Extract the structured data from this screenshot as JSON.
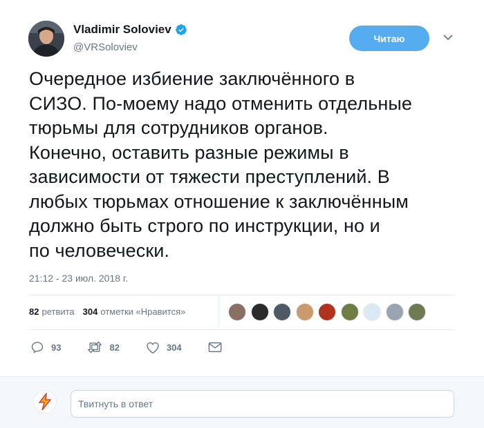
{
  "author": {
    "name": "Vladimir Soloviev",
    "handle": "@VRSoloviev",
    "verified": true
  },
  "follow_button": {
    "label": "Читаю",
    "color": "#55acee"
  },
  "tweet": {
    "lines": [
      "Очередное избиение заключённого в",
      "СИЗО. По-моему надо отменить отдельные",
      "тюрьмы для сотрудников органов.",
      "Конечно, оставить разные режимы в",
      "зависимости от тяжести преступлений. В",
      "любых тюрьмах отношение к заключённым",
      "должно быть строго по инструкции, но и",
      "по человечески."
    ],
    "timestamp": "21:12 - 23 июл. 2018 г."
  },
  "stats": {
    "retweets_count": "82",
    "retweets_label": "ретвита",
    "likes_count": "304",
    "likes_label": "отметки «Нравится»"
  },
  "likers": [
    {
      "color": "#8a6f63"
    },
    {
      "color": "#2b2b2b"
    },
    {
      "color": "#4f5a66"
    },
    {
      "color": "#c99a6e"
    },
    {
      "color": "#b1331f"
    },
    {
      "color": "#6f7d45"
    },
    {
      "color": "#dbe9f5"
    },
    {
      "color": "#9aa5b1"
    },
    {
      "color": "#6f7a52"
    }
  ],
  "actions": {
    "replies": "93",
    "retweets": "82",
    "likes": "304"
  },
  "reply": {
    "placeholder": "Твитнуть в ответ"
  },
  "colors": {
    "accent": "#1da1f2",
    "muted": "#657786"
  }
}
